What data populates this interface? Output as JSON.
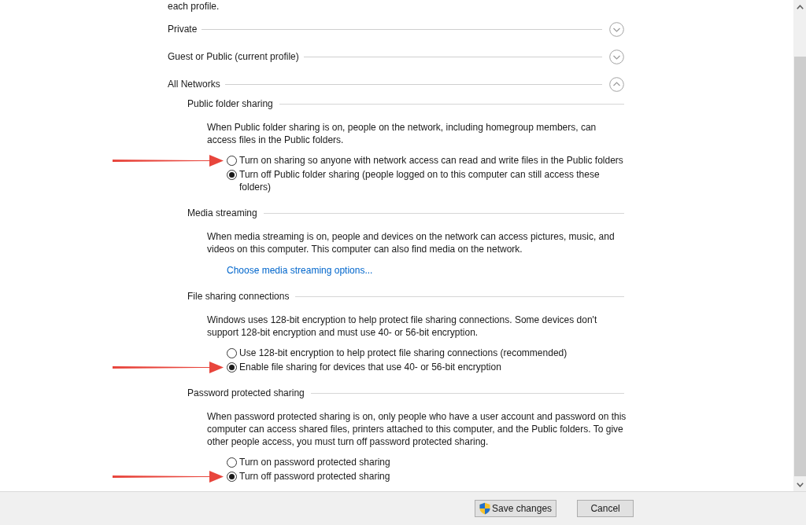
{
  "intro": "each profile.",
  "profiles": [
    {
      "name": "Private",
      "expanded": false
    },
    {
      "name": "Guest or Public (current profile)",
      "expanded": false
    },
    {
      "name": "All Networks",
      "expanded": true,
      "sections": [
        {
          "title": "Public folder sharing",
          "description": "When Public folder sharing is on, people on the network, including homegroup members, can access files in the Public folders.",
          "options": [
            {
              "label": "Turn on sharing so anyone with network access can read and write files in the Public folders",
              "selected": false,
              "arrow": true
            },
            {
              "label": "Turn off Public folder sharing (people logged on to this computer can still access these folders)",
              "selected": true,
              "arrow": false
            }
          ]
        },
        {
          "title": "Media streaming",
          "description": "When media streaming is on, people and devices on the network can access pictures, music, and videos on this computer. This computer can also find media on the network.",
          "link": "Choose media streaming options..."
        },
        {
          "title": "File sharing connections",
          "description": "Windows uses 128-bit encryption to help protect file sharing connections. Some devices don't support 128-bit encryption and must use 40- or 56-bit encryption.",
          "options": [
            {
              "label": "Use 128-bit encryption to help protect file sharing connections (recommended)",
              "selected": false,
              "arrow": false
            },
            {
              "label": "Enable file sharing for devices that use 40- or 56-bit encryption",
              "selected": true,
              "arrow": true
            }
          ]
        },
        {
          "title": "Password protected sharing",
          "description": "When password protected sharing is on, only people who have a user account and password on this computer can access shared files, printers attached to this computer, and the Public folders. To give other people access, you must turn off password protected sharing.",
          "options": [
            {
              "label": "Turn on password protected sharing",
              "selected": false,
              "arrow": false
            },
            {
              "label": "Turn off password protected sharing",
              "selected": true,
              "arrow": true
            }
          ]
        }
      ]
    }
  ],
  "buttons": [
    {
      "label": "Save changes",
      "kind": "admin"
    },
    {
      "label": "Cancel",
      "kind": "plain"
    }
  ]
}
